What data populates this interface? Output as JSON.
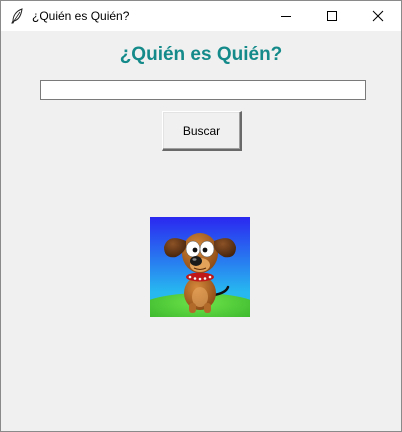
{
  "window": {
    "title": "¿Quién es Quién?",
    "icon": "feather-icon",
    "controls": [
      "minimize-icon",
      "maximize-icon",
      "close-icon"
    ]
  },
  "main": {
    "heading": "¿Quién es Quién?",
    "heading_color": "#158a8a",
    "search": {
      "value": "",
      "placeholder": ""
    },
    "search_button_label": "Buscar",
    "image": "cartoon-dog-avatar"
  }
}
